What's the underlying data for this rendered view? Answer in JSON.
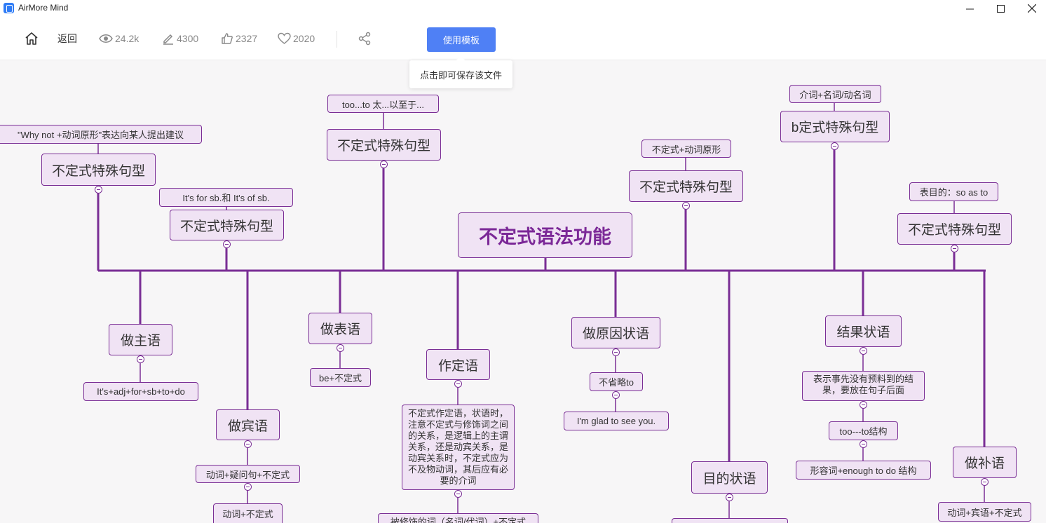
{
  "window": {
    "title": "AirMore Mind",
    "controls": [
      "minimize-icon",
      "maximize-icon",
      "close-icon"
    ]
  },
  "toolbar": {
    "back_label": "返回",
    "views": "24.2k",
    "edits": "4300",
    "likes": "2327",
    "favorites": "2020",
    "use_template_label": "使用模板",
    "tooltip": "点击即可保存该文件",
    "icons": [
      "home-icon",
      "eye-icon",
      "pencil-icon",
      "thumbs-up-icon",
      "heart-icon",
      "share-icon"
    ]
  },
  "colors": {
    "accent": "#4f80f5",
    "branch_line": "#7a2e95",
    "node_fill": "#f0e3f4",
    "center_text": "#7b2897",
    "canvas_bg": "#f7f6f7"
  },
  "mindmap": {
    "center": "不定式语法功能",
    "upper": [
      {
        "label": "不定式特殊句型",
        "note": "\"Why  not  +动词原形\"表达向某人提出建议"
      },
      {
        "label": "不定式特殊句型",
        "note": "It's  for  sb.和  It's  of  sb."
      },
      {
        "label": "不定式特殊句型",
        "note": "too...to  太...以至于..."
      },
      {
        "label": "不定式特殊句型",
        "note": "不定式+动词原形"
      },
      {
        "label": "b定式特殊句型",
        "note": "介词+名词/动名词"
      },
      {
        "label": "不定式特殊句型",
        "note": "表目的：so as to"
      }
    ],
    "lower": [
      {
        "label": "做主语",
        "children": [
          "It's+adj+for+sb+to+do"
        ]
      },
      {
        "label": "做宾语",
        "children": [
          "动词+疑问句+不定式",
          "动词+不定式"
        ]
      },
      {
        "label": "做表语",
        "children": [
          "be+不定式"
        ]
      },
      {
        "label": "作定语",
        "children": [
          "不定式作定语，状语时，注意不定式与修饰词之间的关系，是逻辑上的主谓关系，还是动宾关系，是动宾关系时，不定式应为不及物动词，其后应有必要的介词",
          "被修饰的词（名词/代词）+不定式"
        ]
      },
      {
        "label": "做原因状语",
        "children": [
          "不省略to",
          "I'm glad to see you."
        ]
      },
      {
        "label": "目的状语",
        "children": []
      },
      {
        "label": "结果状语",
        "children": [
          "表示事先没有预料到的结果，要放在句子后面",
          "too---to结构",
          "形容词+enough to  do 结构"
        ]
      },
      {
        "label": "做补语",
        "children": [
          "动词+宾语+不定式"
        ]
      }
    ]
  }
}
